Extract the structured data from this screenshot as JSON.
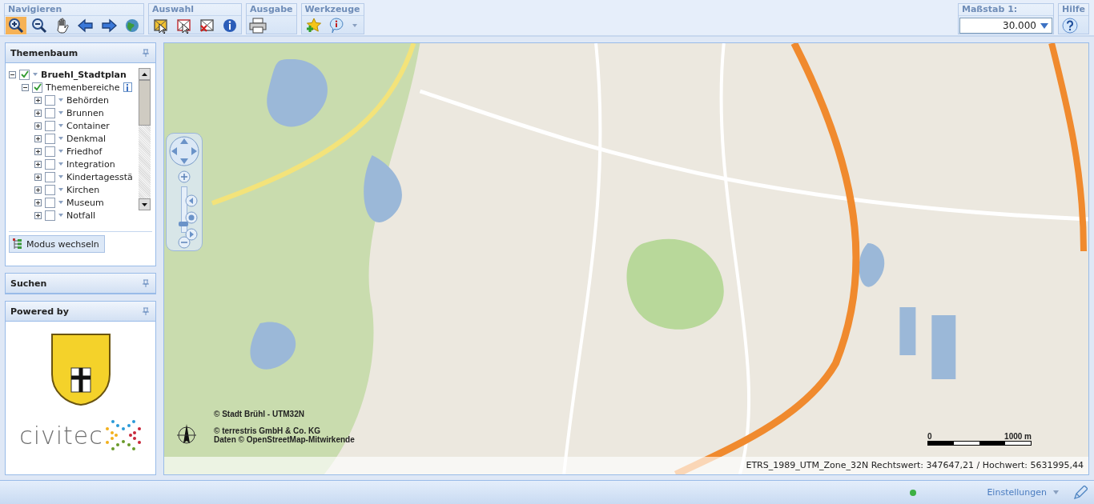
{
  "toolbar": {
    "groups": [
      {
        "title": "Navigieren",
        "tools": [
          {
            "kind": "zoom-in",
            "selected": true
          },
          {
            "kind": "zoom-out",
            "selected": false
          },
          {
            "kind": "pan",
            "selected": false
          },
          {
            "kind": "back",
            "selected": false
          },
          {
            "kind": "forward",
            "selected": false
          },
          {
            "kind": "globe",
            "selected": false
          }
        ]
      },
      {
        "title": "Auswahl",
        "tools": [
          {
            "kind": "select",
            "selected": false
          },
          {
            "kind": "select-area",
            "selected": false
          },
          {
            "kind": "clear-selection",
            "selected": false
          },
          {
            "kind": "info",
            "selected": false
          }
        ]
      },
      {
        "title": "Ausgabe",
        "tools": [
          {
            "kind": "print",
            "selected": false
          }
        ]
      },
      {
        "title": "Werkzeuge",
        "tools": [
          {
            "kind": "star-add",
            "selected": false
          },
          {
            "kind": "info-bubble",
            "selected": false
          },
          {
            "kind": "caret",
            "selected": false
          }
        ]
      }
    ],
    "scale": {
      "title": "Maßstab 1:",
      "value": "30.000"
    },
    "help": {
      "title": "Hilfe"
    }
  },
  "sidebar": {
    "tree_panel": {
      "title": "Themenbaum",
      "tree": [
        {
          "label": "Bruehl_Stadtplan",
          "checked": true,
          "expanded": true,
          "children": [
            {
              "label": "Themenbereiche",
              "checked": true,
              "expanded": true,
              "info": true,
              "children": [
                {
                  "label": "Behörden",
                  "checked": false,
                  "expanded": false
                },
                {
                  "label": "Brunnen",
                  "checked": false,
                  "expanded": false
                },
                {
                  "label": "Container",
                  "checked": false,
                  "expanded": false
                },
                {
                  "label": "Denkmal",
                  "checked": false,
                  "expanded": false
                },
                {
                  "label": "Friedhof",
                  "checked": false,
                  "expanded": false
                },
                {
                  "label": "Integration",
                  "checked": false,
                  "expanded": false
                },
                {
                  "label": "Kindertagesstä",
                  "checked": false,
                  "expanded": false
                },
                {
                  "label": "Kirchen",
                  "checked": false,
                  "expanded": false
                },
                {
                  "label": "Museum",
                  "checked": false,
                  "expanded": false
                },
                {
                  "label": "Notfall",
                  "checked": false,
                  "expanded": false
                }
              ]
            }
          ]
        }
      ],
      "mode_button": "Modus wechseln"
    },
    "search_panel": {
      "title": "Suchen"
    },
    "powered_panel": {
      "title": "Powered by",
      "logo_text": "civitec"
    }
  },
  "map": {
    "zoom_slider": {
      "level": 0.15
    },
    "copyright_lines": [
      "© Stadt Brühl  - UTM32N",
      "© terrestris GmbH & Co. KG",
      "Daten © OpenStreetMap-Mitwirkende"
    ],
    "scale_bar": {
      "start": "0",
      "end": "1000 m"
    },
    "coordinates": "ETRS_1989_UTM_Zone_32N Rechtswert: 347647,21 / Hochwert: 5631995,44"
  },
  "status_bar": {
    "status_dot": {
      "color": "#3cb043"
    },
    "menu": "Einstellungen"
  }
}
